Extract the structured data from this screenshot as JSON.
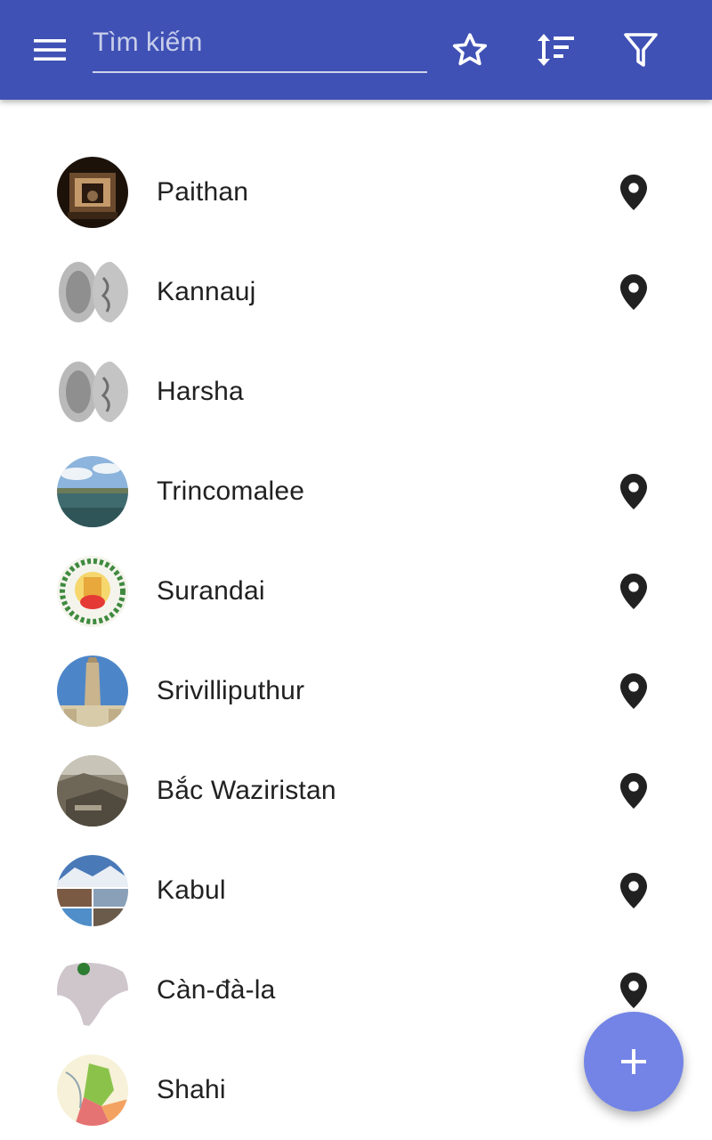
{
  "appbar": {
    "background": "#3f51b5",
    "menu_icon": "hamburger-menu-icon",
    "search_placeholder": "Tìm kiếm",
    "search_value": "",
    "actions": [
      "star-outline-icon",
      "sort-icon",
      "filter-icon"
    ]
  },
  "list": {
    "items": [
      {
        "label": "Paithan",
        "thumbnail": "temple-interior-photo",
        "has_location": true
      },
      {
        "label": "Kannauj",
        "thumbnail": "silver-coin-photo",
        "has_location": true
      },
      {
        "label": "Harsha",
        "thumbnail": "silver-coin-photo",
        "has_location": false
      },
      {
        "label": "Trincomalee",
        "thumbnail": "bay-landscape-photo",
        "has_location": true
      },
      {
        "label": "Surandai",
        "thumbnail": "emblem-seal-image",
        "has_location": true
      },
      {
        "label": "Srivilliputhur",
        "thumbnail": "gopuram-tower-photo",
        "has_location": true
      },
      {
        "label": "Bắc Waziristan",
        "thumbnail": "mountain-town-photo",
        "has_location": true
      },
      {
        "label": "Kabul",
        "thumbnail": "city-collage-photo",
        "has_location": true
      },
      {
        "label": "Càn-đà-la",
        "thumbnail": "region-map-image",
        "has_location": true
      },
      {
        "label": "Shahi",
        "thumbnail": "historical-map-image",
        "has_location": false
      }
    ]
  },
  "fab": {
    "icon": "plus-icon",
    "color": "#7384e6"
  },
  "colors": {
    "text": "#212121",
    "pin": "#212121",
    "background": "#ffffff"
  }
}
